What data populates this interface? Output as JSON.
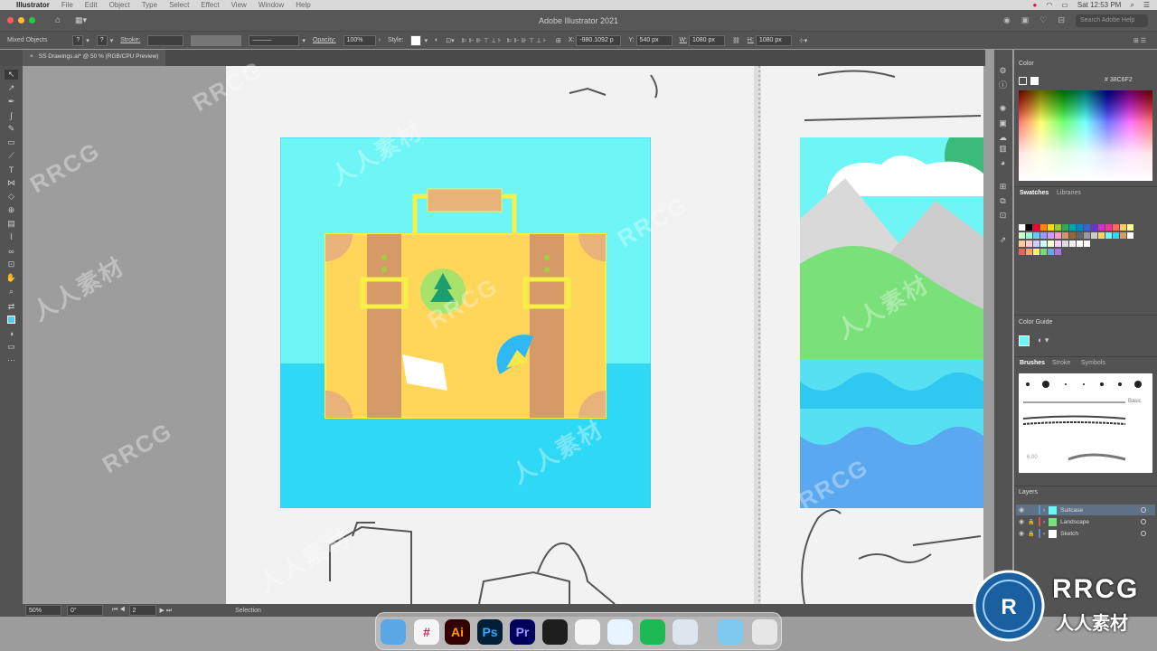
{
  "menubar": {
    "apple": "",
    "items": [
      "Illustrator",
      "File",
      "Edit",
      "Object",
      "Type",
      "Select",
      "Effect",
      "View",
      "Window",
      "Help"
    ],
    "clock": "Sat 12:53 PM"
  },
  "titlebar": {
    "title": "Adobe Illustrator 2021",
    "search_placeholder": "Search Adobe Help"
  },
  "controlbar": {
    "selection_label": "Mixed Objects",
    "stroke_label": "Stroke:",
    "opacity_label": "Opacity:",
    "opacity_value": "100%",
    "style_label": "Style:",
    "x_label": "X:",
    "x_value": "-980.1092 p",
    "y_label": "Y:",
    "y_value": "540 px",
    "w_label": "W:",
    "w_value": "1080 px",
    "h_label": "H:",
    "h_value": "1080 px"
  },
  "document": {
    "tab_label": "SS Drawings.ai* @ 50 % (RGB/CPU Preview)"
  },
  "statusbar": {
    "zoom": "50%",
    "rotation": "0°",
    "artboard": "2",
    "tool": "Selection"
  },
  "panels": {
    "color": {
      "title": "Color",
      "hex": "38C6F2"
    },
    "swatches": {
      "tabs": [
        "Swatches",
        "Libraries"
      ]
    },
    "color_guide": {
      "title": "Color Guide"
    },
    "brushes": {
      "tabs": [
        "Brushes",
        "Stroke",
        "Symbols"
      ],
      "basic_label": "Basic",
      "size_label": "6.00"
    },
    "layers": {
      "title": "Layers",
      "items": [
        {
          "name": "Suitcase",
          "color": "#4f9fd6"
        },
        {
          "name": "Landscape",
          "color": "#e05050"
        },
        {
          "name": "Sketch",
          "color": "#5a8ad8"
        }
      ]
    }
  },
  "dock": {
    "apps": [
      {
        "name": "finder-icon",
        "label": "",
        "bg": "#5aa9e6",
        "fg": "#fff"
      },
      {
        "name": "slack-icon",
        "label": "#",
        "bg": "#f5f5f5",
        "fg": "#e01e5a"
      },
      {
        "name": "illustrator-icon",
        "label": "Ai",
        "bg": "#330000",
        "fg": "#ff9a00"
      },
      {
        "name": "photoshop-icon",
        "label": "Ps",
        "bg": "#001e36",
        "fg": "#31a8ff"
      },
      {
        "name": "premiere-icon",
        "label": "Pr",
        "bg": "#00005b",
        "fg": "#9999ff"
      },
      {
        "name": "figma-icon",
        "label": "",
        "bg": "#1e1e1e",
        "fg": "#f24e1e"
      },
      {
        "name": "chrome-icon",
        "label": "",
        "bg": "#f5f5f5",
        "fg": "#4285f4"
      },
      {
        "name": "safari-icon",
        "label": "",
        "bg": "#e8f4ff",
        "fg": "#1a8cff"
      },
      {
        "name": "spotify-icon",
        "label": "",
        "bg": "#1db954",
        "fg": "#000"
      },
      {
        "name": "quicktime-icon",
        "label": "",
        "bg": "#dde6ee",
        "fg": "#2a7ab8"
      },
      {
        "name": "folder-icon",
        "label": "",
        "bg": "#7fc9f0",
        "fg": "#fff"
      },
      {
        "name": "trash-icon",
        "label": "",
        "bg": "#e6e6e6",
        "fg": "#999"
      }
    ]
  },
  "watermark": {
    "text_latin": "RRCG",
    "text_cjk": "人人素材"
  },
  "colors": {
    "sky": "#6ef6f6",
    "sea": "#2fd9f6",
    "suitcase": "#ffd55a",
    "strap": "#d69a68",
    "handle": "#e8b27a",
    "outline": "#f8f24a",
    "selection": "#38c6f2"
  }
}
